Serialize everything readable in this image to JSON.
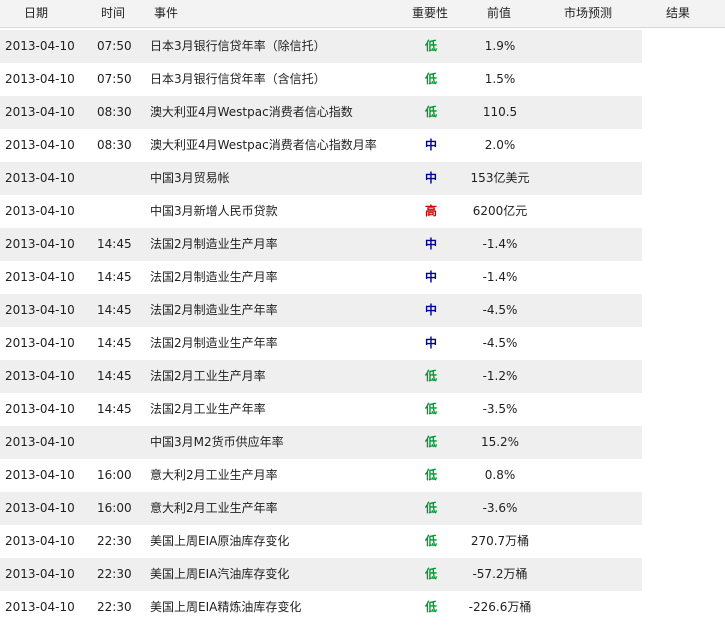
{
  "header": {
    "date": "日期",
    "time": "时间",
    "event": "事件",
    "importance": "重要性",
    "previous": "前值",
    "forecast": "市场预测",
    "actual": "结果"
  },
  "colors": {
    "low": "#009933",
    "medium": "#000099",
    "high": "#cc0000",
    "shaded_row": "#efefef",
    "header_bg": "#f3f3f3"
  },
  "rows": [
    {
      "date": "2013-04-10",
      "time": "07:50",
      "event": "日本3月银行信贷年率（除信托）",
      "importance": "低",
      "level": "low",
      "previous": "1.9%",
      "forecast": "",
      "actual": ""
    },
    {
      "date": "2013-04-10",
      "time": "07:50",
      "event": "日本3月银行信贷年率（含信托）",
      "importance": "低",
      "level": "low",
      "previous": "1.5%",
      "forecast": "",
      "actual": ""
    },
    {
      "date": "2013-04-10",
      "time": "08:30",
      "event": "澳大利亚4月Westpac消费者信心指数",
      "importance": "低",
      "level": "low",
      "previous": "110.5",
      "forecast": "",
      "actual": ""
    },
    {
      "date": "2013-04-10",
      "time": "08:30",
      "event": "澳大利亚4月Westpac消费者信心指数月率",
      "importance": "中",
      "level": "medium",
      "previous": "2.0%",
      "forecast": "",
      "actual": ""
    },
    {
      "date": "2013-04-10",
      "time": "",
      "event": "中国3月贸易帐",
      "importance": "中",
      "level": "medium",
      "previous": "153亿美元",
      "forecast": "",
      "actual": ""
    },
    {
      "date": "2013-04-10",
      "time": "",
      "event": "中国3月新增人民币贷款",
      "importance": "高",
      "level": "high",
      "previous": "6200亿元",
      "forecast": "",
      "actual": ""
    },
    {
      "date": "2013-04-10",
      "time": "14:45",
      "event": "法国2月制造业生产月率",
      "importance": "中",
      "level": "medium",
      "previous": "-1.4%",
      "forecast": "",
      "actual": ""
    },
    {
      "date": "2013-04-10",
      "time": "14:45",
      "event": "法国2月制造业生产月率",
      "importance": "中",
      "level": "medium",
      "previous": "-1.4%",
      "forecast": "",
      "actual": ""
    },
    {
      "date": "2013-04-10",
      "time": "14:45",
      "event": "法国2月制造业生产年率",
      "importance": "中",
      "level": "medium",
      "previous": "-4.5%",
      "forecast": "",
      "actual": ""
    },
    {
      "date": "2013-04-10",
      "time": "14:45",
      "event": "法国2月制造业生产年率",
      "importance": "中",
      "level": "medium",
      "previous": "-4.5%",
      "forecast": "",
      "actual": ""
    },
    {
      "date": "2013-04-10",
      "time": "14:45",
      "event": "法国2月工业生产月率",
      "importance": "低",
      "level": "low",
      "previous": "-1.2%",
      "forecast": "",
      "actual": ""
    },
    {
      "date": "2013-04-10",
      "time": "14:45",
      "event": "法国2月工业生产年率",
      "importance": "低",
      "level": "low",
      "previous": "-3.5%",
      "forecast": "",
      "actual": ""
    },
    {
      "date": "2013-04-10",
      "time": "",
      "event": "中国3月M2货币供应年率",
      "importance": "低",
      "level": "low",
      "previous": "15.2%",
      "forecast": "",
      "actual": ""
    },
    {
      "date": "2013-04-10",
      "time": "16:00",
      "event": "意大利2月工业生产月率",
      "importance": "低",
      "level": "low",
      "previous": "0.8%",
      "forecast": "",
      "actual": ""
    },
    {
      "date": "2013-04-10",
      "time": "16:00",
      "event": "意大利2月工业生产年率",
      "importance": "低",
      "level": "low",
      "previous": "-3.6%",
      "forecast": "",
      "actual": ""
    },
    {
      "date": "2013-04-10",
      "time": "22:30",
      "event": "美国上周EIA原油库存变化",
      "importance": "低",
      "level": "low",
      "previous": "270.7万桶",
      "forecast": "",
      "actual": ""
    },
    {
      "date": "2013-04-10",
      "time": "22:30",
      "event": "美国上周EIA汽油库存变化",
      "importance": "低",
      "level": "low",
      "previous": "-57.2万桶",
      "forecast": "",
      "actual": ""
    },
    {
      "date": "2013-04-10",
      "time": "22:30",
      "event": "美国上周EIA精炼油库存变化",
      "importance": "低",
      "level": "low",
      "previous": "-226.6万桶",
      "forecast": "",
      "actual": ""
    }
  ]
}
